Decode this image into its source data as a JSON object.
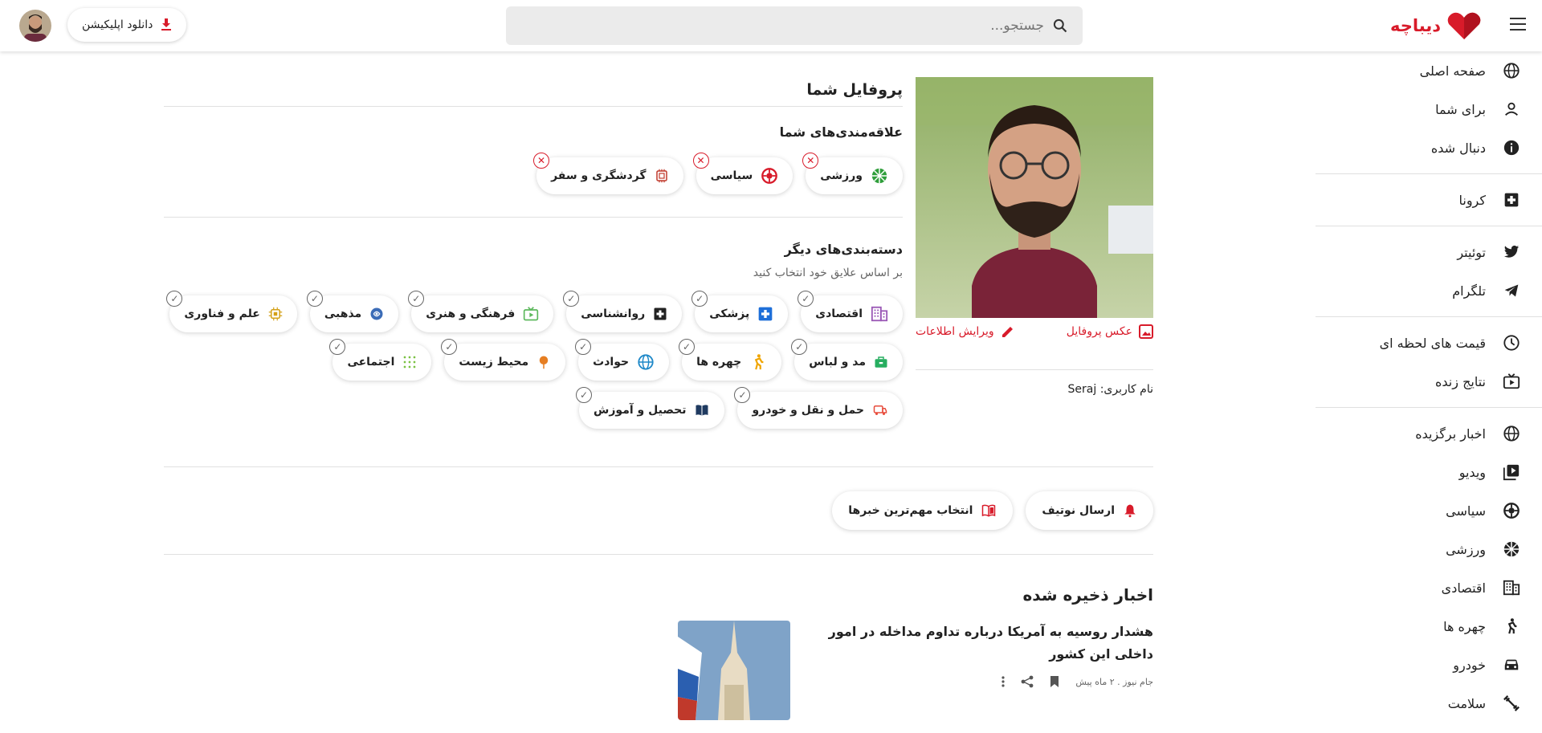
{
  "header": {
    "logo_text": "دیباچه",
    "brand_color": "#d81b2a",
    "search_placeholder": "جستجو...",
    "download_label": "دانلود اپلیکیشن"
  },
  "sidebar": {
    "groups": [
      [
        {
          "label": "صفحه اصلی",
          "icon": "globe-icon"
        },
        {
          "label": "برای شما",
          "icon": "person-icon"
        },
        {
          "label": "دنبال شده",
          "icon": "info-icon"
        }
      ],
      [
        {
          "label": "کرونا",
          "icon": "medical-plus-icon"
        }
      ],
      [
        {
          "label": "توئیتر",
          "icon": "twitter-icon"
        },
        {
          "label": "تلگرام",
          "icon": "telegram-icon"
        }
      ],
      [
        {
          "label": "قیمت های لحظه ای",
          "icon": "clock-icon"
        },
        {
          "label": "نتایج زنده",
          "icon": "live-tv-icon"
        }
      ],
      [
        {
          "label": "اخبار برگزیده",
          "icon": "globe-icon"
        },
        {
          "label": "ویدیو",
          "icon": "video-icon"
        },
        {
          "label": "سیاسی",
          "icon": "politics-icon"
        },
        {
          "label": "ورزشی",
          "icon": "sports-icon"
        },
        {
          "label": "اقتصادی",
          "icon": "building-icon"
        },
        {
          "label": "چهره ها",
          "icon": "figure-icon"
        },
        {
          "label": "خودرو",
          "icon": "car-icon"
        },
        {
          "label": "سلامت",
          "icon": "fitness-icon"
        }
      ]
    ]
  },
  "profile": {
    "title": "پروفایل شما",
    "photo_label": "عکس پروفایل",
    "edit_label": "ویرایش اطلاعات",
    "username_label": "نام کاربری:",
    "username": "Seraj",
    "interests_title": "علاقه‌مندی‌های شما",
    "interests": [
      {
        "label": "ورزشی",
        "icon": "sports-icon",
        "color": "#2e9e3a"
      },
      {
        "label": "سیاسی",
        "icon": "politics-icon",
        "color": "#d81b2a"
      },
      {
        "label": "گردشگری و سفر",
        "icon": "travel-icon",
        "color": "#c0392b"
      }
    ],
    "other_title": "دسته‌بندی‌های دیگر",
    "other_subtitle": "بر اساس علایق خود انتخاب کنید",
    "other_categories": [
      {
        "label": "اقتصادی",
        "icon": "building-icon",
        "color": "#9b59b6"
      },
      {
        "label": "پزشکی",
        "icon": "medical-plus-icon",
        "color": "#1e6fd9"
      },
      {
        "label": "روانشناسی",
        "icon": "psychology-icon",
        "color": "#222222"
      },
      {
        "label": "فرهنگی و هنری",
        "icon": "culture-tv-icon",
        "color": "#5cb85c"
      },
      {
        "label": "مذهبی",
        "icon": "religion-icon",
        "color": "#3b6cb7"
      },
      {
        "label": "علم و فناوری",
        "icon": "chip-icon",
        "color": "#d4a017"
      },
      {
        "label": "مد و لباس",
        "icon": "fashion-icon",
        "color": "#27ae60"
      },
      {
        "label": "چهره ها",
        "icon": "figure-icon",
        "color": "#f0a500"
      },
      {
        "label": "حوادث",
        "icon": "globe-icon",
        "color": "#1e88c8"
      },
      {
        "label": "محیط زیست",
        "icon": "tree-icon",
        "color": "#e67e22"
      },
      {
        "label": "اجتماعی",
        "icon": "grid-icon",
        "color": "#7ac143"
      },
      {
        "label": "حمل و نقل و خودرو",
        "icon": "transport-icon",
        "color": "#e74c3c"
      },
      {
        "label": "تحصیل و آموزش",
        "icon": "book-icon",
        "color": "#1f3a60"
      }
    ],
    "actions": [
      {
        "label": "ارسال نوتیف",
        "icon": "bell-icon"
      },
      {
        "label": "انتخاب مهم‌ترین خبرها",
        "icon": "news-book-icon"
      }
    ]
  },
  "saved": {
    "title": "اخبار ذخیره شده",
    "items": [
      {
        "title": "هشدار روسیه به آمریکا درباره تداوم مداخله در امور داخلی این کشور",
        "meta": "جام نیوز . ۲ ماه پیش"
      }
    ]
  }
}
